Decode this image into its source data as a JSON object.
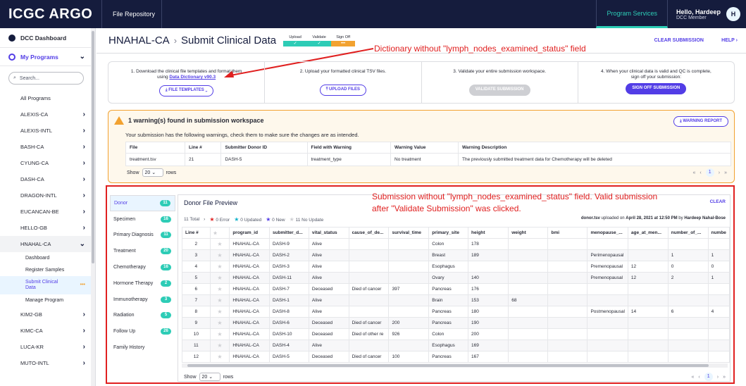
{
  "nav": {
    "logo": "ICGC ARGO",
    "file_repository": "File Repository",
    "program_services": "Program Services",
    "hello": "Hello, Hardeep",
    "role": "DCC Member",
    "avatar": "H"
  },
  "sidebar": {
    "dcc_dashboard": "DCC Dashboard",
    "my_programs": "My Programs",
    "search_placeholder": "Search...",
    "all_programs": "All Programs",
    "programs_before": [
      "ALEXIS-CA",
      "ALEXIS-INTL",
      "BASH-CA",
      "CYUNG-CA",
      "DASH-CA",
      "DRAGON-INTL",
      "EUCANCAN-BE",
      "HELLO-GB"
    ],
    "open_program": "HNAHAL-CA",
    "sub_items": [
      "Dashboard",
      "Register Samples",
      "Submit Clinical Data",
      "Manage Program"
    ],
    "programs_after": [
      "KIM2-GB",
      "KIMC-CA",
      "LUCA-KR",
      "MUTO-INTL"
    ]
  },
  "header": {
    "program": "HNAHAL-CA",
    "page": "Submit Clinical Data",
    "steps": [
      "Upload",
      "Validate",
      "Sign Off"
    ],
    "step_marks": [
      "✓",
      "✓",
      "•••"
    ],
    "clear_submission": "CLEAR SUBMISSION",
    "help": "HELP"
  },
  "annotations": {
    "dictionary": "Dictionary without \"lymph_nodes_examined_status\" field",
    "submission_line1": "Submission without \"lymph_nodes_examined_status\" field. Valid submission",
    "submission_line2": "after \"Validate Submission\" was clicked."
  },
  "instructions": {
    "step1_text": "1. Download the clinical file templates and format them",
    "step1_using": "using ",
    "step1_link": "Data Dictionary v90.3",
    "file_templates": "FILE TEMPLATES",
    "step2_text": "2. Upload your formatted clinical TSV files.",
    "upload_files": "UPLOAD FILES",
    "step3_text": "3. Validate your entire submission workspace.",
    "validate_submission": "VALIDATE SUBMISSION",
    "step4_text": "4. When your clinical data is valid and QC is complete,",
    "step4_text2": "sign off your submission:",
    "sign_off": "SIGN OFF SUBMISSION"
  },
  "warning": {
    "title": "1 warning(s) found in submission workspace",
    "description": "Your submission has the following warnings, check them to make sure the changes are as intended.",
    "report_button": "WARNING REPORT",
    "columns": [
      "File",
      "Line #",
      "Submitter Donor ID",
      "Field with Warning",
      "Warning Value",
      "Warning Description"
    ],
    "rows": [
      [
        "treatment.tsv",
        "21",
        "DASH-5",
        "treatment_type",
        "No treatment",
        "The previously submitted treatment data for Chemotherapy will be deleted"
      ]
    ],
    "show": "Show",
    "page_size": "20",
    "rows_label": "rows",
    "page": "1"
  },
  "tabs": [
    {
      "label": "Donor",
      "count": "11"
    },
    {
      "label": "Specimen",
      "count": "16"
    },
    {
      "label": "Primary Diagnosis",
      "count": "11"
    },
    {
      "label": "Treatment",
      "count": "20"
    },
    {
      "label": "Chemotherapy",
      "count": "16"
    },
    {
      "label": "Hormone Therapy",
      "count": "2"
    },
    {
      "label": "Immunotherapy",
      "count": "3"
    },
    {
      "label": "Radiation",
      "count": "5"
    },
    {
      "label": "Follow Up",
      "count": "26"
    },
    {
      "label": "Family History",
      "count": ""
    }
  ],
  "preview": {
    "title": "Donor File Preview",
    "clear": "CLEAR",
    "total": "11 Total",
    "error": "0 Error",
    "updated": "0 Updated",
    "new": "0 New",
    "no_update": "11 No Update",
    "uploaded_file": "donor.tsv",
    "uploaded_text": " uploaded on ",
    "uploaded_date": "April 28, 2021 at 12:50 PM",
    "uploaded_by": " by ",
    "uploaded_user": "Hardeep Nahal-Bose",
    "columns": [
      "Line #",
      "★",
      "program_id",
      "submitter_d...",
      "vital_status",
      "cause_of_de...",
      "survival_time",
      "primary_site",
      "height",
      "weight",
      "bmi",
      "menopause_...",
      "age_at_men...",
      "number_of_...",
      "numbe"
    ],
    "rows": [
      [
        "2",
        "★",
        "HNAHAL-CA",
        "DASH-9",
        "Alive",
        "",
        "",
        "Colon",
        "178",
        "",
        "",
        "",
        "",
        "",
        ""
      ],
      [
        "3",
        "★",
        "HNAHAL-CA",
        "DASH-2",
        "Alive",
        "",
        "",
        "Breast",
        "189",
        "",
        "",
        "Perimenopausal",
        "",
        "1",
        "1"
      ],
      [
        "4",
        "★",
        "HNAHAL-CA",
        "DASH-3",
        "Alive",
        "",
        "",
        "Esophagus",
        "",
        "",
        "",
        "Premenopausal",
        "12",
        "0",
        "0"
      ],
      [
        "5",
        "★",
        "HNAHAL-CA",
        "DASH-11",
        "Alive",
        "",
        "",
        "Ovary",
        "140",
        "",
        "",
        "Premenopausal",
        "12",
        "2",
        "1"
      ],
      [
        "6",
        "★",
        "HNAHAL-CA",
        "DASH-7",
        "Deceased",
        "Died of cancer",
        "397",
        "Pancreas",
        "176",
        "",
        "",
        "",
        "",
        "",
        ""
      ],
      [
        "7",
        "★",
        "HNAHAL-CA",
        "DASH-1",
        "Alive",
        "",
        "",
        "Brain",
        "153",
        "68",
        "",
        "",
        "",
        "",
        ""
      ],
      [
        "8",
        "★",
        "HNAHAL-CA",
        "DASH-8",
        "Alive",
        "",
        "",
        "Pancreas",
        "180",
        "",
        "",
        "Postmenopausal",
        "14",
        "6",
        "4"
      ],
      [
        "9",
        "★",
        "HNAHAL-CA",
        "DASH-6",
        "Deceased",
        "Died of cancer",
        "200",
        "Pancreas",
        "190",
        "",
        "",
        "",
        "",
        "",
        ""
      ],
      [
        "10",
        "★",
        "HNAHAL-CA",
        "DASH-10",
        "Deceased",
        "Died of other re",
        "926",
        "Colon",
        "200",
        "",
        "",
        "",
        "",
        "",
        ""
      ],
      [
        "11",
        "★",
        "HNAHAL-CA",
        "DASH-4",
        "Alive",
        "",
        "",
        "Esophagus",
        "169",
        "",
        "",
        "",
        "",
        "",
        ""
      ],
      [
        "12",
        "★",
        "HNAHAL-CA",
        "DASH-5",
        "Deceased",
        "Died of cancer",
        "100",
        "Pancreas",
        "167",
        "",
        "",
        "",
        "",
        "",
        ""
      ]
    ],
    "show": "Show",
    "page_size": "20",
    "rows_label": "rows",
    "page": "1"
  }
}
